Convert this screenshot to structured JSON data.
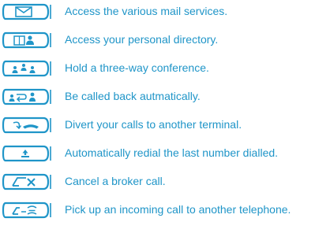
{
  "colors": {
    "accent": "#1f95c8"
  },
  "items": [
    {
      "icon": "mail-icon",
      "label": "Access the various mail services."
    },
    {
      "icon": "personal-directory-icon",
      "label": "Access your personal directory."
    },
    {
      "icon": "conference-icon",
      "label": "Hold a three-way conference."
    },
    {
      "icon": "callback-icon",
      "label": "Be called back autmatically."
    },
    {
      "icon": "divert-call-icon",
      "label": "Divert your calls to another terminal."
    },
    {
      "icon": "redial-icon",
      "label": "Automatically redial the last number dialled."
    },
    {
      "icon": "cancel-broker-call-icon",
      "label": "Cancel a broker call."
    },
    {
      "icon": "call-pickup-icon",
      "label": "Pick up an incoming call to another telephone."
    }
  ]
}
